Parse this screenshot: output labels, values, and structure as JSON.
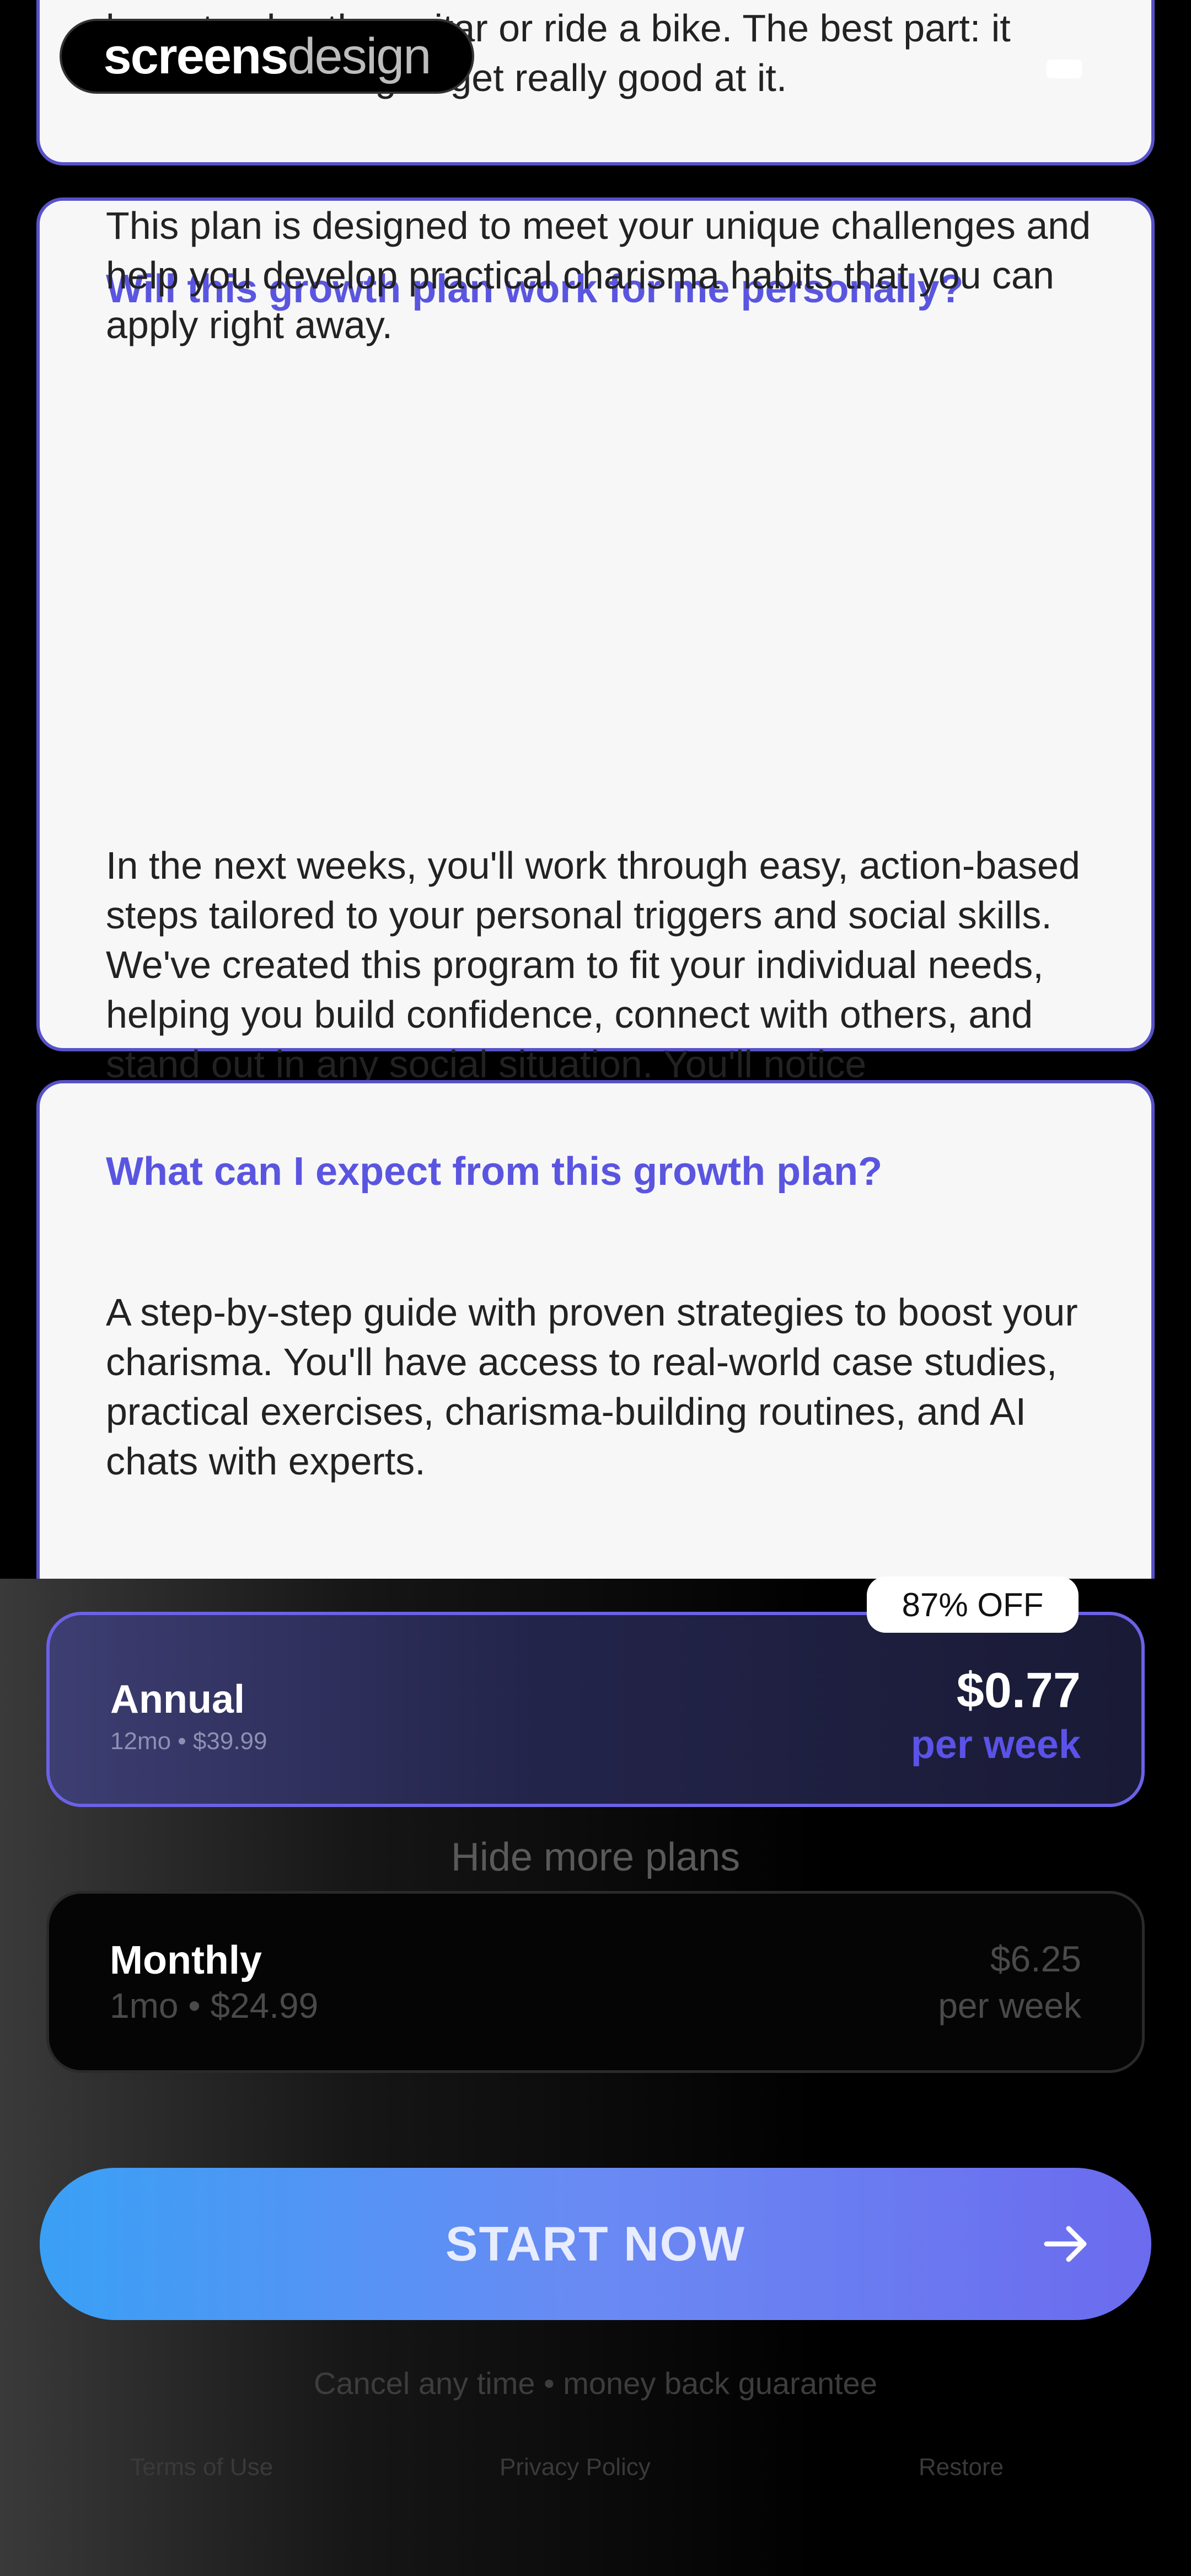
{
  "brand": {
    "logo_primary": "screens",
    "logo_secondary": "design"
  },
  "faq": [
    {
      "question": "",
      "paragraphs": [
        "learn to play the guitar or ride a bike. The best part: it doesn't take long to get really good at it."
      ]
    },
    {
      "question": "Will this growth plan work for me personally?",
      "paragraphs": [
        "This plan is designed to meet your unique challenges and help you develop practical charisma habits that you can apply right away.",
        "In the next weeks, you'll work through easy, action-based steps tailored to your personal triggers and social skills. We've created this program to fit your individual needs, helping you build confidence, connect with others, and stand out in any social situation. You'll notice improvements from day one, and you'll feel more confident in no time."
      ]
    },
    {
      "question": "What can I expect from this growth plan?",
      "paragraphs": [
        "A step-by-step guide with proven strategies to boost your charisma. You'll have access to real-world case studies, practical exercises, charisma-building routines, and AI chats with experts."
      ]
    }
  ],
  "plans": {
    "annual": {
      "badge": "87% OFF",
      "name": "Annual",
      "sub": "12mo • $39.99",
      "price": "$0.77",
      "unit": "per week",
      "selected": true
    },
    "toggle_label": "Hide more plans",
    "monthly": {
      "name": "Monthly",
      "sub": "1mo • $24.99",
      "price": "$6.25",
      "unit": "per week",
      "selected": false
    }
  },
  "cta": {
    "label": "START NOW",
    "icon": "arrow-right-icon"
  },
  "guarantee": "Cancel any time • money back guarantee",
  "footer": {
    "terms": "Terms of Use",
    "privacy": "Privacy Policy",
    "restore": "Restore"
  },
  "colors": {
    "accent": "#5a55e0",
    "card_border": "#5752c8",
    "cta_start": "#3aa0f5",
    "cta_end": "#6b6bee",
    "annual_unit": "#5b52e8"
  }
}
